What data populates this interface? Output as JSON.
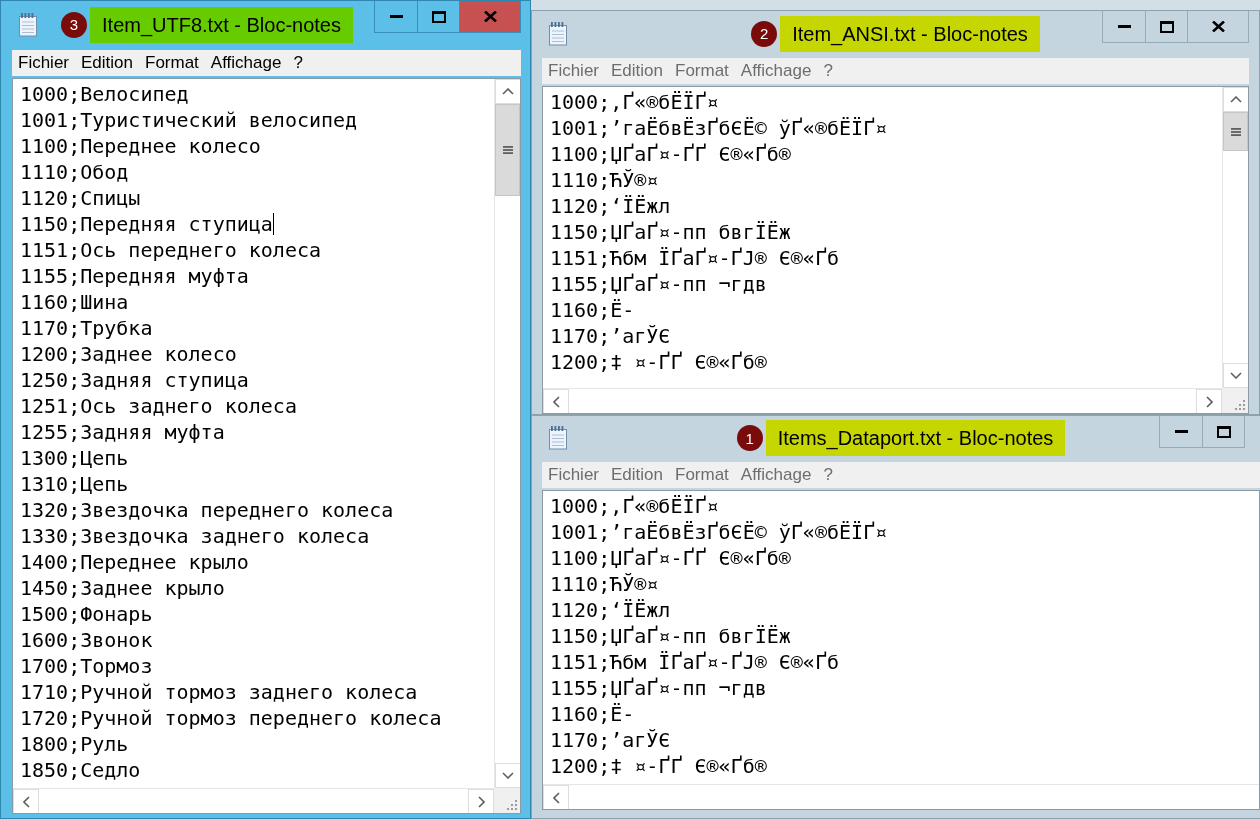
{
  "windows": [
    {
      "badge": "3",
      "title": "Item_UTF8.txt - Bloc-notes",
      "color": "#66cc00",
      "active": true,
      "cut_off": false,
      "menu": [
        "Fichier",
        "Edition",
        "Format",
        "Affichage",
        "?"
      ],
      "lines": [
        {
          "text": "1000;Велосипед",
          "caret": false
        },
        {
          "text": "1001;Туристический велосипед",
          "caret": false
        },
        {
          "text": "1100;Переднее колесо",
          "caret": false
        },
        {
          "text": "1110;Обод",
          "caret": false
        },
        {
          "text": "1120;Спицы",
          "caret": false
        },
        {
          "text": "1150;Передняя ступица",
          "caret": true
        },
        {
          "text": "1151;Ось переднего колеса",
          "caret": false
        },
        {
          "text": "1155;Передняя муфта",
          "caret": false
        },
        {
          "text": "1160;Шина",
          "caret": false
        },
        {
          "text": "1170;Трубка",
          "caret": false
        },
        {
          "text": "1200;Заднее колесо",
          "caret": false
        },
        {
          "text": "1250;Задняя ступица",
          "caret": false
        },
        {
          "text": "1251;Ось заднего колеса",
          "caret": false
        },
        {
          "text": "1255;Задняя муфта",
          "caret": false
        },
        {
          "text": "1300;Цепь",
          "caret": false
        },
        {
          "text": "1310;Цепь",
          "caret": false
        },
        {
          "text": "1320;Звездочка переднего колеса",
          "caret": false
        },
        {
          "text": "1330;Звездочка заднего колеса",
          "caret": false
        },
        {
          "text": "1400;Переднее крыло",
          "caret": false
        },
        {
          "text": "1450;Заднее крыло",
          "caret": false
        },
        {
          "text": "1500;Фонарь",
          "caret": false
        },
        {
          "text": "1600;Звонок",
          "caret": false
        },
        {
          "text": "1700;Тормоз",
          "caret": false
        },
        {
          "text": "1710;Ручной тормоз заднего колеса",
          "caret": false
        },
        {
          "text": "1720;Ручной тормоз переднего колеса",
          "caret": false
        },
        {
          "text": "1800;Руль",
          "caret": false
        },
        {
          "text": "1850;Седло",
          "caret": false
        }
      ]
    },
    {
      "badge": "2",
      "title": "Item_ANSI.txt - Bloc-notes",
      "color": "#c5d600",
      "active": false,
      "cut_off": false,
      "menu": [
        "Fichier",
        "Edition",
        "Format",
        "Affichage",
        "?"
      ],
      "lines": [
        {
          "text": "1000;‚Ґ«®бЁЇҐ¤",
          "caret": false
        },
        {
          "text": "1001;’гаЁбвЁзҐбЄЁ© ўҐ«®бЁЇҐ¤",
          "caret": false
        },
        {
          "text": "1100;ЏҐаҐ¤-ҐҐ Є®«Ґб®",
          "caret": false
        },
        {
          "text": "1110;ЋЎ®¤",
          "caret": false
        },
        {
          "text": "1120;‘ЇЁжл",
          "caret": false
        },
        {
          "text": "1150;ЏҐаҐ¤-пп бвгЇЁж",
          "caret": false
        },
        {
          "text": "1151;Ћбм ЇҐаҐ¤-ҐЈ® Є®«Ґб",
          "caret": false
        },
        {
          "text": "1155;ЏҐаҐ¤-пп ¬гдв",
          "caret": false
        },
        {
          "text": "1160;Ё-",
          "caret": false
        },
        {
          "text": "1170;’агЎЄ",
          "caret": false
        },
        {
          "text": "1200;‡ ¤-ҐҐ Є®«Ґб®",
          "caret": false
        }
      ]
    },
    {
      "badge": "1",
      "title": "Items_Dataport.txt - Bloc-notes",
      "color": "#c5d600",
      "active": false,
      "cut_off": true,
      "menu": [
        "Fichier",
        "Edition",
        "Format",
        "Affichage",
        "?"
      ],
      "lines": [
        {
          "text": "1000;‚Ґ«®бЁЇҐ¤",
          "caret": false
        },
        {
          "text": "1001;’гаЁбвЁзҐбЄЁ© ўҐ«®бЁЇҐ¤",
          "caret": false
        },
        {
          "text": "1100;ЏҐаҐ¤-ҐҐ Є®«Ґб®",
          "caret": false
        },
        {
          "text": "1110;ЋЎ®¤",
          "caret": false
        },
        {
          "text": "1120;‘ЇЁжл",
          "caret": false
        },
        {
          "text": "1150;ЏҐаҐ¤-пп бвгЇЁж",
          "caret": false
        },
        {
          "text": "1151;Ћбм ЇҐаҐ¤-ҐЈ® Є®«Ґб",
          "caret": false
        },
        {
          "text": "1155;ЏҐаҐ¤-пп ¬гдв",
          "caret": false
        },
        {
          "text": "1160;Ё-",
          "caret": false
        },
        {
          "text": "1170;’агЎЄ",
          "caret": false
        },
        {
          "text": "1200;‡ ¤-ҐҐ Є®«Ґб®",
          "caret": false
        }
      ]
    }
  ]
}
